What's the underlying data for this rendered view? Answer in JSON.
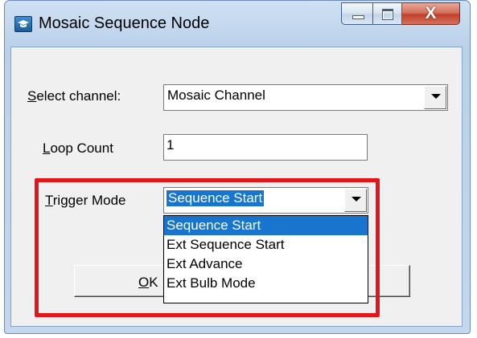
{
  "window": {
    "title": "Mosaic Sequence Node",
    "close_glyph": "X",
    "app_icon": "app-icon"
  },
  "form": {
    "select_channel": {
      "label_prefix": "",
      "label_accel": "S",
      "label_rest": "elect channel:",
      "value": "Mosaic Channel"
    },
    "loop_count": {
      "label_accel": "L",
      "label_rest": "oop Count",
      "value": "1"
    },
    "trigger_mode": {
      "label_accel": "T",
      "label_rest": "rigger Mode",
      "value": "Sequence Start",
      "options": [
        "Sequence Start",
        "Ext Sequence Start",
        "Ext Advance",
        "Ext Bulb Mode"
      ],
      "selected_index": 0
    }
  },
  "buttons": {
    "ok_accel": "O",
    "ok_rest": "K"
  },
  "colors": {
    "highlight_frame": "#e4141b",
    "selection": "#1874cd"
  }
}
